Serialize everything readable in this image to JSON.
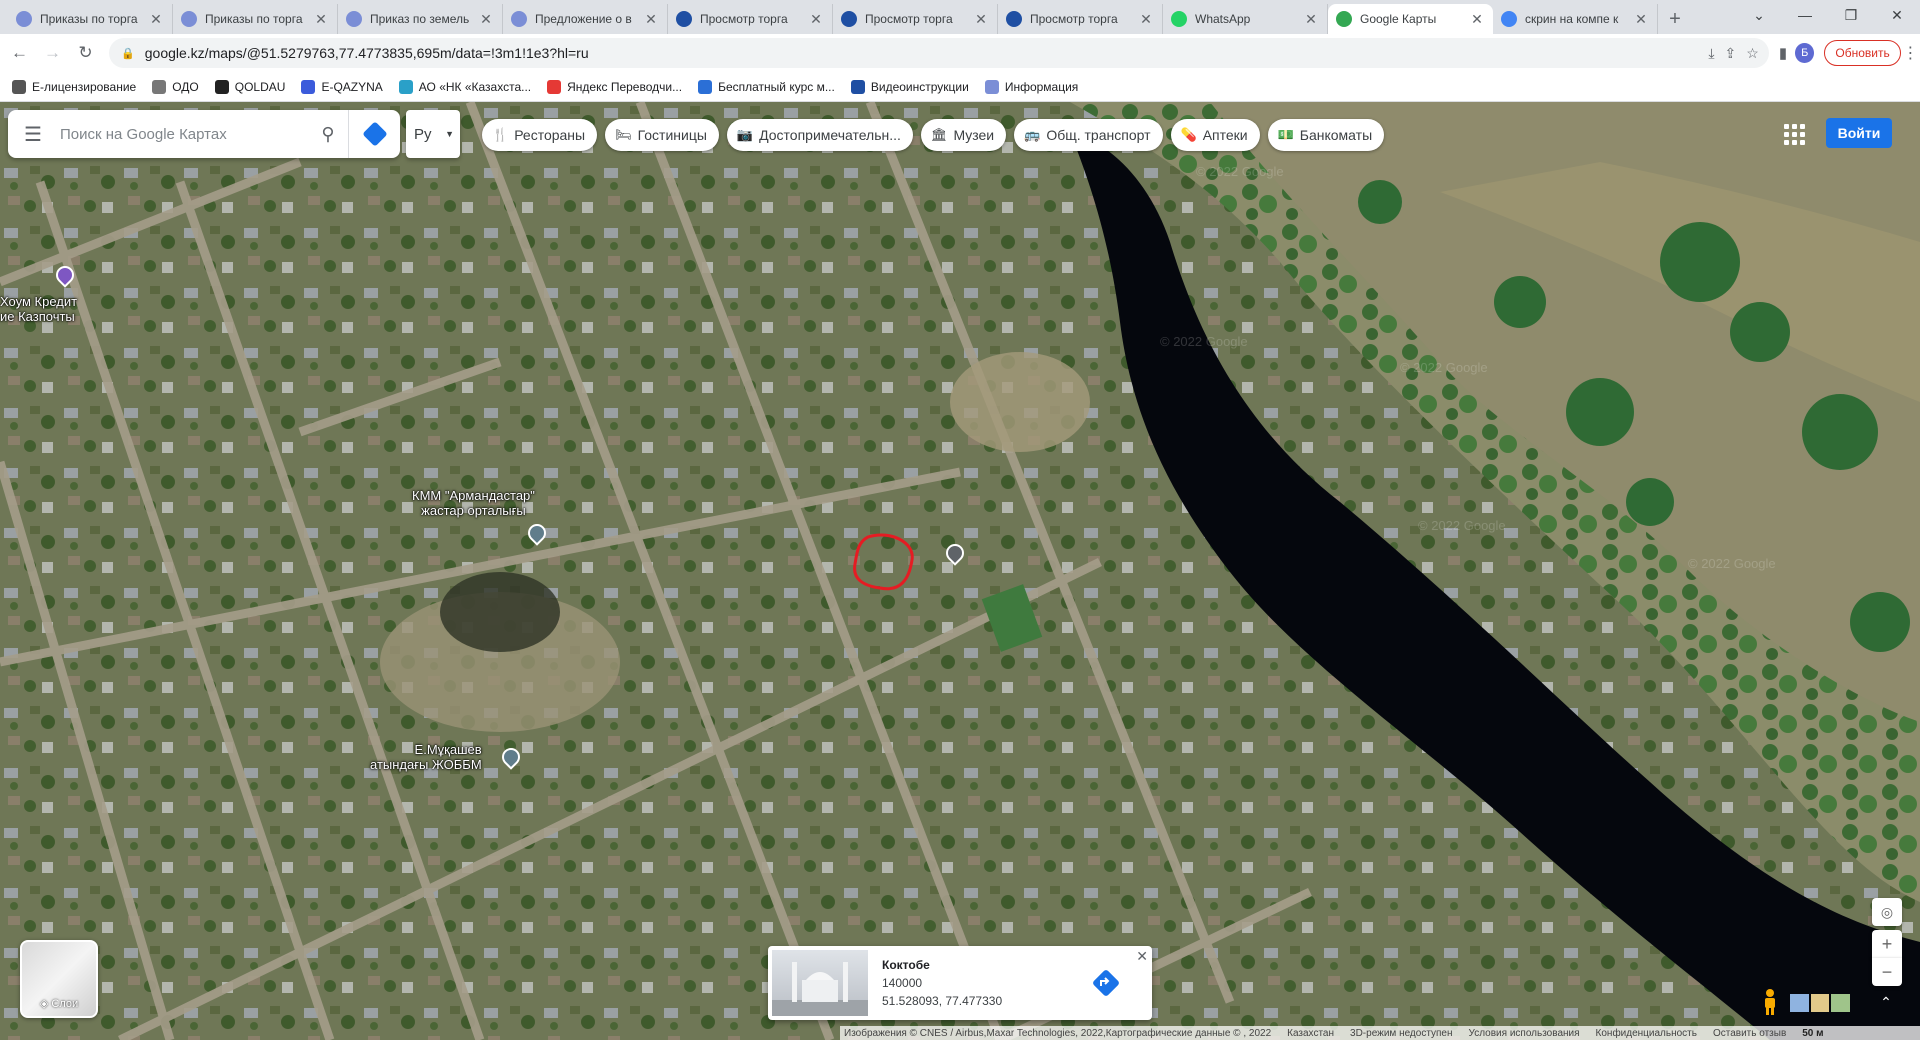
{
  "tabs": [
    {
      "title": "Приказы по торга",
      "color": "#7b8ed6",
      "active": false
    },
    {
      "title": "Приказы по торга",
      "color": "#7b8ed6",
      "active": false
    },
    {
      "title": "Приказ по земель",
      "color": "#7b8ed6",
      "active": false
    },
    {
      "title": "Предложение о в",
      "color": "#7b8ed6",
      "active": false
    },
    {
      "title": "Просмотр торга",
      "color": "#1f4fa3",
      "active": false
    },
    {
      "title": "Просмотр торга",
      "color": "#1f4fa3",
      "active": false
    },
    {
      "title": "Просмотр торга",
      "color": "#1f4fa3",
      "active": false
    },
    {
      "title": "WhatsApp",
      "color": "#25d366",
      "active": false
    },
    {
      "title": "Google Карты",
      "color": "#34a853",
      "active": true
    },
    {
      "title": "скрин на компе к",
      "color": "#4285f4",
      "active": false
    }
  ],
  "address": {
    "url": "google.kz/maps/@51.5279763,77.4773835,695m/data=!3m1!1e3?hl=ru",
    "profile_initial": "Б",
    "update_label": "Обновить"
  },
  "bookmarks": [
    {
      "label": "Е-лицензирование",
      "color": "#555"
    },
    {
      "label": "ОДО",
      "color": "#777"
    },
    {
      "label": "QOLDAU",
      "color": "#222"
    },
    {
      "label": "E-QAZYNA",
      "color": "#3b5bdb"
    },
    {
      "label": "АО «НК «Казахста...",
      "color": "#2aa0c8"
    },
    {
      "label": "Яндекс Переводчи...",
      "color": "#e53935"
    },
    {
      "label": "Бесплатный курс м...",
      "color": "#2b6fd6"
    },
    {
      "label": "Видеоинструкции",
      "color": "#1f4fa3"
    },
    {
      "label": "Информация",
      "color": "#7b8ed6"
    }
  ],
  "search": {
    "placeholder": "Поиск на Google Картах",
    "lang": "Ру"
  },
  "chips": [
    {
      "icon": "🍴",
      "label": "Рестораны",
      "icon_name": "restaurant-icon"
    },
    {
      "icon": "🛏",
      "label": "Гостиницы",
      "icon_name": "hotel-icon"
    },
    {
      "icon": "📷",
      "label": "Достопримечательн...",
      "icon_name": "attractions-icon"
    },
    {
      "icon": "🏛",
      "label": "Музеи",
      "icon_name": "museum-icon"
    },
    {
      "icon": "🚌",
      "label": "Общ. транспорт",
      "icon_name": "transit-icon"
    },
    {
      "icon": "💊",
      "label": "Аптеки",
      "icon_name": "pharmacy-icon"
    },
    {
      "icon": "💵",
      "label": "Банкоматы",
      "icon_name": "atm-icon"
    }
  ],
  "signin_label": "Войти",
  "map_labels": {
    "home_credit_1": "Хоум Кредит",
    "home_credit_2": "ие Казпочты",
    "kmm_1": "КММ \"Армандастар\"",
    "kmm_2": "жастар орталығы",
    "school_1": "Е.Мұқашев",
    "school_2": "атындағы ЖОББМ"
  },
  "layers_label": "Слои",
  "card": {
    "title": "Коктобе",
    "postcode": "140000",
    "coords": "51.528093, 77.477330"
  },
  "footer": {
    "imagery": "Изображения © CNES / Airbus,Maxar Technologies, 2022,Картографические данные © , 2022",
    "country": "Казахстан",
    "mode3d": "3D-режим недоступен",
    "terms": "Условия использования",
    "privacy": "Конфиденциальность",
    "feedback": "Оставить отзыв",
    "scale": "50 м"
  },
  "watermark": "© 2022 Google",
  "colors": {
    "accent": "#1a73e8",
    "marker": "#e51c23",
    "river": "#05070d"
  }
}
